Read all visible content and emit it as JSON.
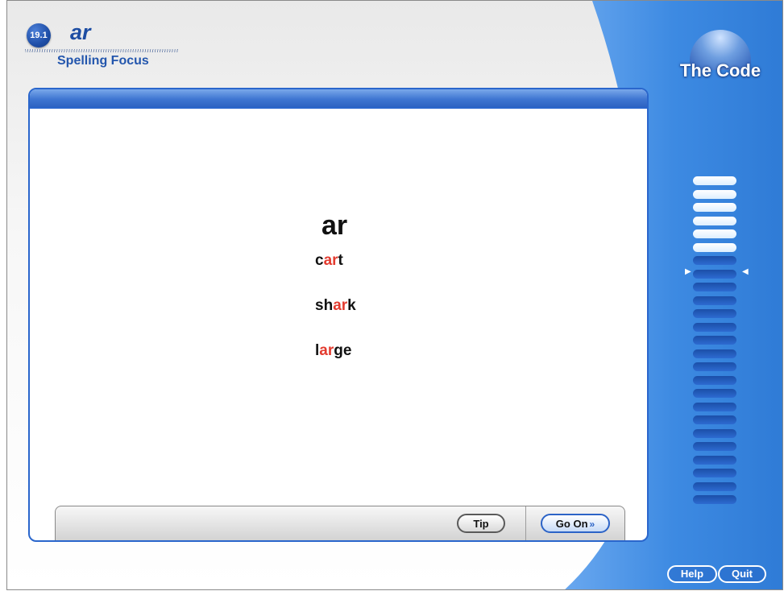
{
  "header": {
    "lesson_number": "19.1",
    "lesson_title": "ar",
    "subtitle": "Spelling Focus",
    "brand": "The Code"
  },
  "content": {
    "heading": "ar",
    "words": [
      {
        "pre": "c",
        "focus": "ar",
        "post": "t"
      },
      {
        "pre": "sh",
        "focus": "ar",
        "post": "k"
      },
      {
        "pre": "l",
        "focus": "ar",
        "post": "ge"
      }
    ],
    "focus_color": "#e33b2f"
  },
  "footer": {
    "tip_label": "Tip",
    "go_on_label": "Go On"
  },
  "progress": {
    "total_steps": 25,
    "completed_steps": 6,
    "current_step": 7
  },
  "utility": {
    "help_label": "Help",
    "quit_label": "Quit"
  },
  "colors": {
    "accent": "#2a66cc",
    "panel_blue": "#3b86e0",
    "highlight": "#e33b2f"
  }
}
